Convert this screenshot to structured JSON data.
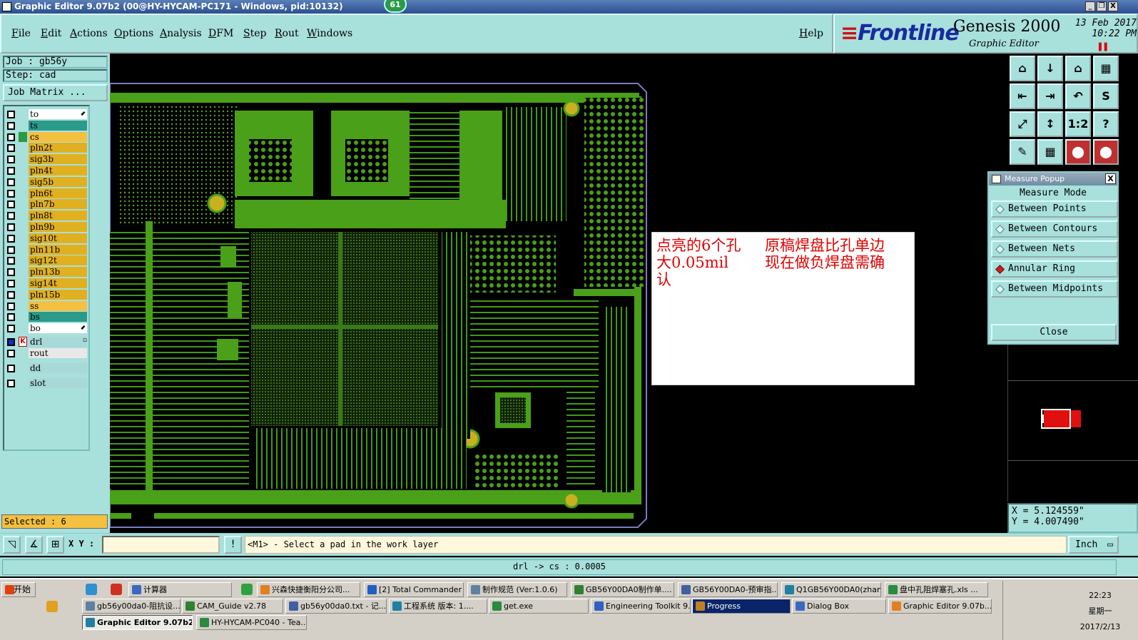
{
  "window": {
    "title": "Graphic Editor 9.07b2 (00@HY-HYCAM-PC171 - Windows, pid:10132)",
    "badge": "61",
    "minimize": "_",
    "restore": "❐",
    "close": "X"
  },
  "menu": {
    "items": [
      "File",
      "Edit",
      "Actions",
      "Options",
      "Analysis",
      "DFM",
      "Step",
      "Rout",
      "Windows"
    ],
    "help": "Help"
  },
  "brand": {
    "logo": "Frontline",
    "product": "Genesis 2000",
    "subtitle": "Graphic Editor",
    "date": "13 Feb 2017",
    "time": "10:22 PM",
    "pause_glyph": "▌▌"
  },
  "job": {
    "job_line": "Job : gb56y",
    "step_line": "Step: cad",
    "matrix_button": "Job Matrix ..."
  },
  "layers": [
    {
      "name": "to",
      "color": "#ffffff",
      "arrow": true
    },
    {
      "name": "ts",
      "color": "#2a9a8a"
    },
    {
      "name": "cs",
      "color": "#f4c040",
      "active": true
    },
    {
      "name": "pln2t",
      "color": "#e0b020"
    },
    {
      "name": "sig3b",
      "color": "#e0b020"
    },
    {
      "name": "pln4t",
      "color": "#e0b020"
    },
    {
      "name": "sig5b",
      "color": "#e0b020"
    },
    {
      "name": "pln6t",
      "color": "#e0b020"
    },
    {
      "name": "pln7b",
      "color": "#e0b020"
    },
    {
      "name": "pln8t",
      "color": "#e0b020"
    },
    {
      "name": "pln9b",
      "color": "#e0b020"
    },
    {
      "name": "sig10t",
      "color": "#e0b020"
    },
    {
      "name": "pln11b",
      "color": "#e0b020"
    },
    {
      "name": "sig12t",
      "color": "#e0b020"
    },
    {
      "name": "pln13b",
      "color": "#e0b020"
    },
    {
      "name": "sig14t",
      "color": "#e0b020"
    },
    {
      "name": "pln15b",
      "color": "#e0b020"
    },
    {
      "name": "ss",
      "color": "#f4c040"
    },
    {
      "name": "bs",
      "color": "#2a9a8a"
    },
    {
      "name": "bo",
      "color": "#ffffff",
      "arrow": true
    },
    {
      "name": "drl",
      "color": "#a8d8d8",
      "work": true
    },
    {
      "name": "rout",
      "color": "#e8e8e8"
    },
    {
      "name": "dd",
      "color": "#a8d8d8"
    },
    {
      "name": "slot",
      "color": "#a8d8d8"
    }
  ],
  "selected": "Selected : 6",
  "note": {
    "col1": "点亮的6个孔大0.05mil认",
    "col1_a": "点亮的6个孔",
    "col1_b": "大0.05mil",
    "col1_c": "认",
    "col2_a": "原稿焊盘比孔单边",
    "col2_b": "现在做负焊盘需确"
  },
  "measure": {
    "title": "Measure Popup",
    "close_x": "X",
    "mode_label": "Measure Mode",
    "options": [
      "Between Points",
      "Between Contours",
      "Between Nets",
      "Annular Ring",
      "Between Midpoints"
    ],
    "active_index": 3,
    "close_button": "Close"
  },
  "tools": [
    "⌂",
    "↓",
    "⌂",
    "▦",
    "⇤",
    "⇥",
    "↶",
    "S",
    "⤢",
    "↕",
    "1:2",
    "?",
    "✎",
    "▦",
    "⬤",
    "⬤"
  ],
  "coords": {
    "x": "X  =  5.124559\"",
    "y": "Y  =  4.007490\""
  },
  "command": {
    "xy_label": "X Y :",
    "xy_value": "",
    "bang": "!",
    "prompt": "<M1> - Select a pad in the work layer",
    "unit": "Inch"
  },
  "status": "drl -> cs : 0.0005",
  "taskbar": {
    "start": "开始",
    "row1": [
      "计算器",
      "兴森快捷衡阳分公司...",
      "[2] Total Commander ...",
      "制作规范 (Ver:1.0.6)",
      "GB56Y00DA0制作单....",
      "GB56Y00DA0-预审指...",
      "Q1GB56Y00DA0(zhan...",
      "盘中孔阻焊塞孔.xls ..."
    ],
    "row2": [
      "gb56y00da0-阻抗设...",
      "CAM_Guide v2.78",
      "gb56y00da0.txt - 记...",
      "工程系统  版本: 1....",
      "get.exe",
      "Engineering Toolkit 9....",
      "Progress",
      "Dialog Box",
      "Graphic Editor 9.07b..."
    ],
    "row3": [
      "Graphic Editor 9.07b2 ...",
      "HY-HYCAM-PC040 - Tea..."
    ],
    "clock_time": "22:23",
    "clock_day": "星期一",
    "clock_date": "2017/2/13"
  }
}
